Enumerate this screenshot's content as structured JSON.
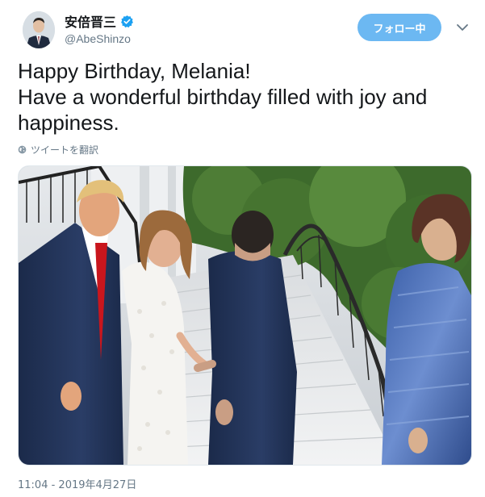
{
  "user": {
    "display_name": "安倍晋三",
    "handle": "@AbeShinzo",
    "verified": true,
    "avatar_icon": "avatar-photo-icon"
  },
  "follow_button": {
    "label": "フォロー中",
    "color": "#6cb8f2"
  },
  "menu": {
    "icon": "chevron-down-icon"
  },
  "tweet": {
    "lines": [
      "Happy Birthday, Melania!",
      "Have a wonderful birthday filled with joy and",
      "happiness."
    ],
    "translate_label": "ツイートを翻訳",
    "translate_icon": "globe-icon",
    "timestamp": "11:04 - 2019年4月27日"
  },
  "media": {
    "type": "photo",
    "icon": "photo-image"
  },
  "colors": {
    "accent": "#1da1f2",
    "text": "#14171a",
    "muted": "#657786"
  }
}
